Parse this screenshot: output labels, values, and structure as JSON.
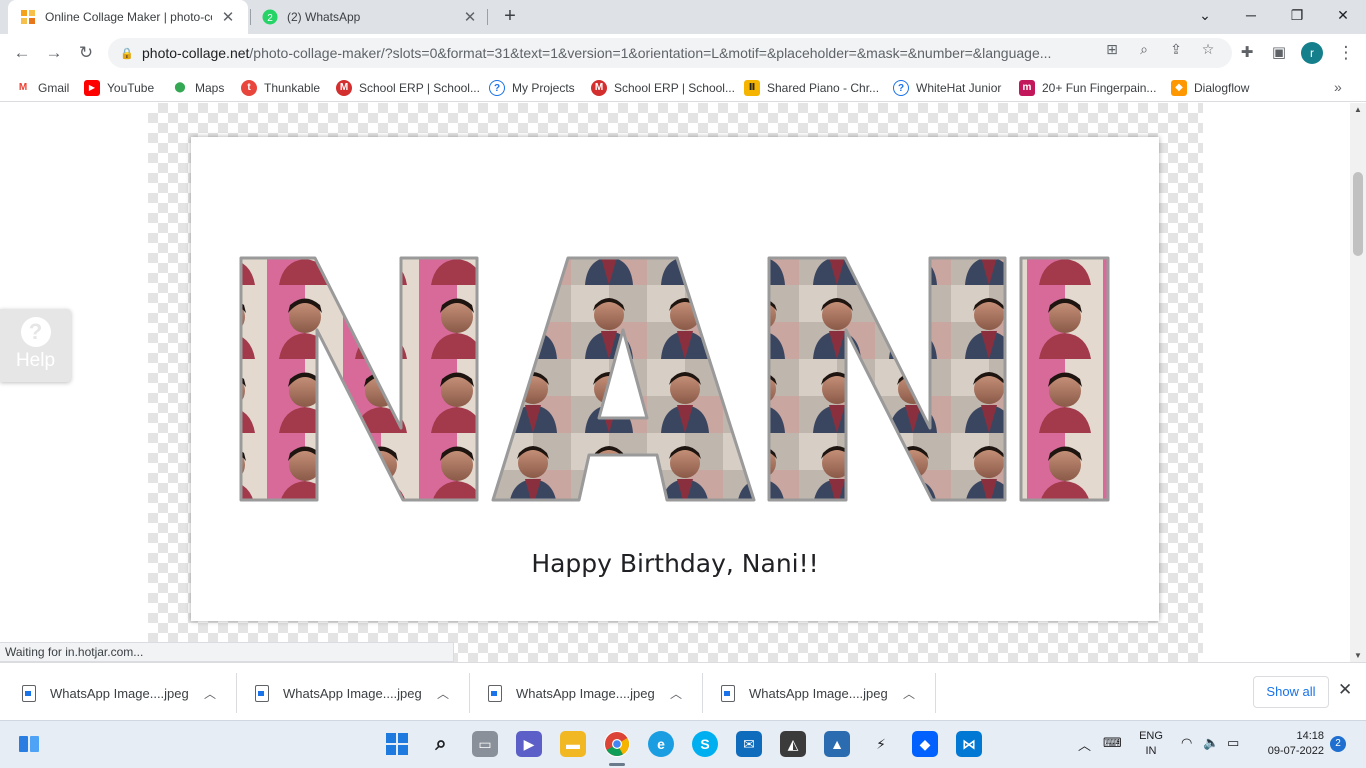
{
  "tabs": [
    {
      "title": "Online Collage Maker | photo-collage",
      "active": true
    },
    {
      "title": "(2) WhatsApp",
      "badge": "2",
      "active": false
    }
  ],
  "window_controls": {
    "list": "⌄",
    "minimize": "─",
    "restore": "❐",
    "close": "✕"
  },
  "toolbar": {
    "url_host": "photo-collage.net",
    "url_path": "/photo-collage-maker/?slots=0&format=31&text=1&version=1&orientation=L&motif=&placeholder=&mask=&number=&language...",
    "profile_initial": "r"
  },
  "bookmarks": [
    {
      "label": "Gmail",
      "icon": "gmail-icon",
      "color": "#ea4335",
      "glyph": "M"
    },
    {
      "label": "YouTube",
      "icon": "youtube-icon",
      "color": "#ff0000",
      "glyph": "▶"
    },
    {
      "label": "Maps",
      "icon": "maps-icon",
      "color": "#34a853",
      "glyph": "●"
    },
    {
      "label": "Thunkable",
      "icon": "thunkable-icon",
      "color": "#e8453c",
      "glyph": "t"
    },
    {
      "label": "School ERP | School...",
      "icon": "school-erp-icon",
      "color": "#d32f2f",
      "glyph": "M"
    },
    {
      "label": "My Projects",
      "icon": "my-projects-icon",
      "color": "#1a73e8",
      "glyph": "?"
    },
    {
      "label": "School ERP | School...",
      "icon": "school-erp-icon",
      "color": "#d32f2f",
      "glyph": "M"
    },
    {
      "label": "Shared Piano - Chr...",
      "icon": "piano-icon",
      "color": "#f4b400",
      "glyph": "Ⅱ"
    },
    {
      "label": "WhiteHat Junior",
      "icon": "whitehat-icon",
      "color": "#1a73e8",
      "glyph": "?"
    },
    {
      "label": "20+ Fun Fingerpain...",
      "icon": "fingerpaint-icon",
      "color": "#c2185b",
      "glyph": "m"
    },
    {
      "label": "Dialogflow",
      "icon": "dialogflow-icon",
      "color": "#ff9800",
      "glyph": "◆"
    }
  ],
  "collage": {
    "word": "NANI",
    "caption": "Happy Birthday, Nani!!"
  },
  "help": {
    "label": "Help",
    "glyph": "?"
  },
  "status_text": "Waiting for in.hotjar.com...",
  "downloads": [
    {
      "name": "WhatsApp Image....jpeg"
    },
    {
      "name": "WhatsApp Image....jpeg"
    },
    {
      "name": "WhatsApp Image....jpeg"
    },
    {
      "name": "WhatsApp Image....jpeg"
    }
  ],
  "show_all_label": "Show all",
  "taskbar": {
    "lang_line1": "ENG",
    "lang_line2": "IN",
    "time": "14:18",
    "date": "09-07-2022",
    "notifications": "2"
  },
  "colors": {
    "accent": "#1a73e8",
    "tab_strip": "#dee1e6",
    "taskbar": "#e6edf5"
  }
}
